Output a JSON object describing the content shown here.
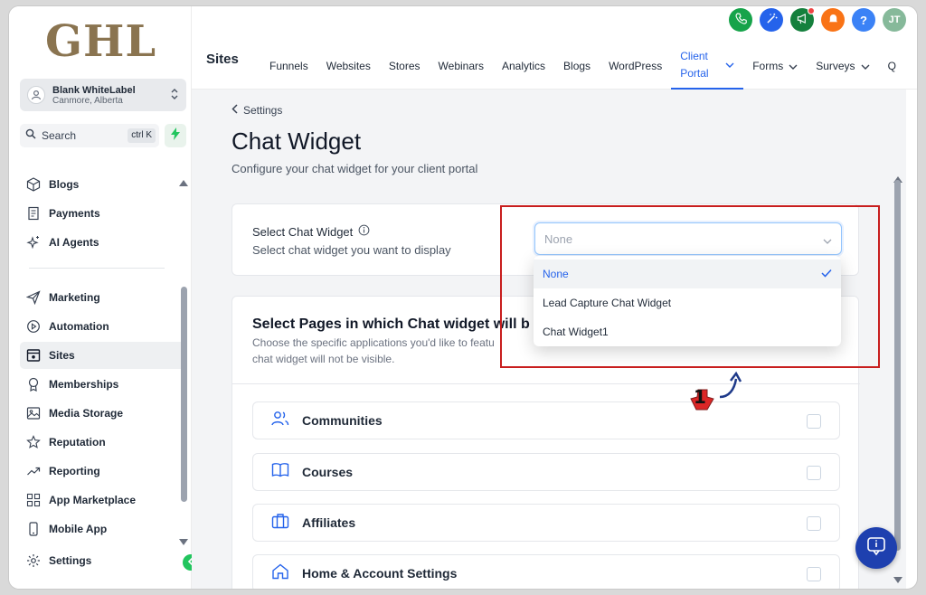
{
  "brand": {
    "logo_text": "GHL"
  },
  "account": {
    "name": "Blank WhiteLabel",
    "location": "Canmore, Alberta"
  },
  "search": {
    "label": "Search",
    "shortcut": "ctrl K"
  },
  "sidebar": {
    "items": [
      {
        "label": "Blogs",
        "icon": "cube-icon"
      },
      {
        "label": "Payments",
        "icon": "receipt-icon"
      },
      {
        "label": "AI Agents",
        "icon": "sparkle-icon"
      },
      {
        "label": "Marketing",
        "icon": "send-icon"
      },
      {
        "label": "Automation",
        "icon": "play-circle-icon"
      },
      {
        "label": "Sites",
        "icon": "browser-icon",
        "active": true
      },
      {
        "label": "Memberships",
        "icon": "award-icon"
      },
      {
        "label": "Media Storage",
        "icon": "image-icon"
      },
      {
        "label": "Reputation",
        "icon": "star-icon"
      },
      {
        "label": "Reporting",
        "icon": "trend-icon"
      },
      {
        "label": "App Marketplace",
        "icon": "grid-icon"
      },
      {
        "label": "Mobile App",
        "icon": "phone-icon"
      },
      {
        "label": "Settings",
        "icon": "gear-icon"
      }
    ]
  },
  "topbar": {
    "section_title": "Sites",
    "tabs": [
      "Funnels",
      "Websites",
      "Stores",
      "Webinars",
      "Analytics",
      "Blogs",
      "WordPress",
      "Client Portal",
      "Forms",
      "Surveys",
      "Q"
    ],
    "active_tab": "Client Portal",
    "avatar_initials": "JT",
    "help_label": "?"
  },
  "page": {
    "back_label": "Settings",
    "title": "Chat Widget",
    "subtitle": "Configure your chat widget for your client portal"
  },
  "chat_widget": {
    "label": "Select Chat Widget",
    "hint": "Select chat widget you want to display",
    "placeholder": "None",
    "options": [
      "None",
      "Lead Capture Chat Widget",
      "Chat Widget1"
    ],
    "selected": "None"
  },
  "pages_section": {
    "heading": "Select Pages in which Chat widget will b",
    "desc_line1": "Choose the specific applications you'd like to featu",
    "desc_line2": "chat widget will not be visible.",
    "apps": [
      {
        "label": "Communities",
        "icon": "users-icon"
      },
      {
        "label": "Courses",
        "icon": "book-icon"
      },
      {
        "label": "Affiliates",
        "icon": "briefcase-icon"
      },
      {
        "label": "Home & Account Settings",
        "icon": "home-icon"
      }
    ]
  },
  "annotation": {
    "step": "1"
  },
  "colors": {
    "accent": "#2563eb",
    "annotation": "#c81e1e",
    "logo": "#8a7450"
  }
}
